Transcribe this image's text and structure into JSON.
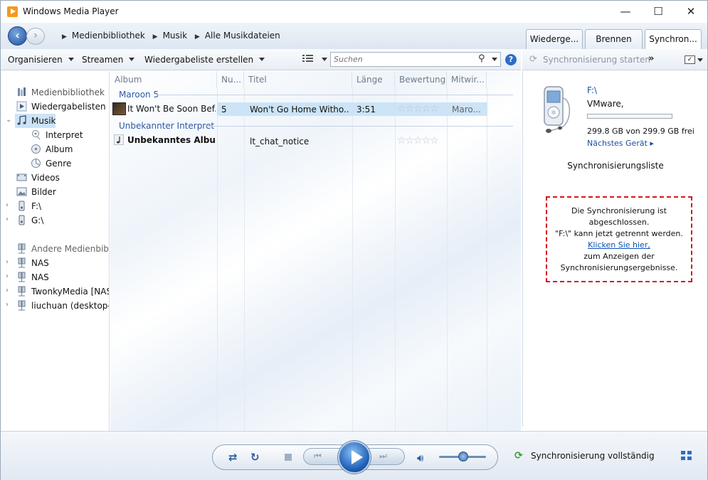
{
  "window": {
    "title": "Windows Media Player",
    "minimize": "—",
    "maximize": "☐",
    "close": "✕"
  },
  "breadcrumb": [
    "Medienbibliothek",
    "Musik",
    "Alle Musikdateien"
  ],
  "tabs": [
    {
      "label": "Wiederge..."
    },
    {
      "label": "Brennen"
    },
    {
      "label": "Synchron..."
    }
  ],
  "toolbar": {
    "organize": "Organisieren",
    "stream": "Streamen",
    "create_playlist": "Wiedergabeliste erstellen",
    "search_placeholder": "Suchen",
    "help": "?"
  },
  "sync_toolbar": {
    "start_sync": "Synchronisierung starten",
    "more": "»"
  },
  "nav": {
    "library": "Medienbibliothek",
    "playlists": "Wiedergabelisten",
    "music": "Musik",
    "artist": "Interpret",
    "album": "Album",
    "genre": "Genre",
    "videos": "Videos",
    "pictures": "Bilder",
    "drive_f": "F:\\",
    "drive_g": "G:\\",
    "other_libraries": "Andere Medienbibliot",
    "nas1": "NAS",
    "nas2": "NAS",
    "twonky": "TwonkyMedia [NAS]",
    "liuchuan": "liuchuan (desktop-q"
  },
  "columns": [
    "Album",
    "Nu...",
    "Titel",
    "Länge",
    "Bewertung",
    "Mitwir..."
  ],
  "groups": [
    {
      "artist": "Maroon 5",
      "album": "It Won't Be Soon Bef...",
      "track_no": "5",
      "title": "Won't Go Home Witho...",
      "length": "3:51",
      "rating": "☆☆☆☆☆",
      "contributor": "Maro..."
    },
    {
      "artist": "Unbekannter Interpret",
      "album": "Unbekanntes Album",
      "track_no": "",
      "title": "lt_chat_notice",
      "length": "",
      "rating": "☆☆☆☆☆",
      "contributor": ""
    }
  ],
  "device": {
    "name": "F:\\",
    "vendor": "VMware,",
    "storage": "299.8 GB von 299.9 GB frei",
    "free_fraction": 0.9997,
    "next_device": "Nächstes Gerät ▸"
  },
  "sync_list": {
    "heading": "Synchronisierungsliste",
    "line1": "Die Synchronisierung ist",
    "line2": "abgeschlossen.",
    "line3": "\"F:\\\" kann jetzt getrennt werden.",
    "link": "Klicken Sie hier,",
    "line4": "zum Anzeigen der",
    "line5": "Synchronisierungsergebnisse."
  },
  "player": {
    "status": "Synchronisierung vollständig"
  },
  "colors": {
    "accent": "#2b5aa8",
    "highlight_row": "#cce4f7",
    "alert_border": "#d5151c",
    "link": "#0b4fb3"
  }
}
